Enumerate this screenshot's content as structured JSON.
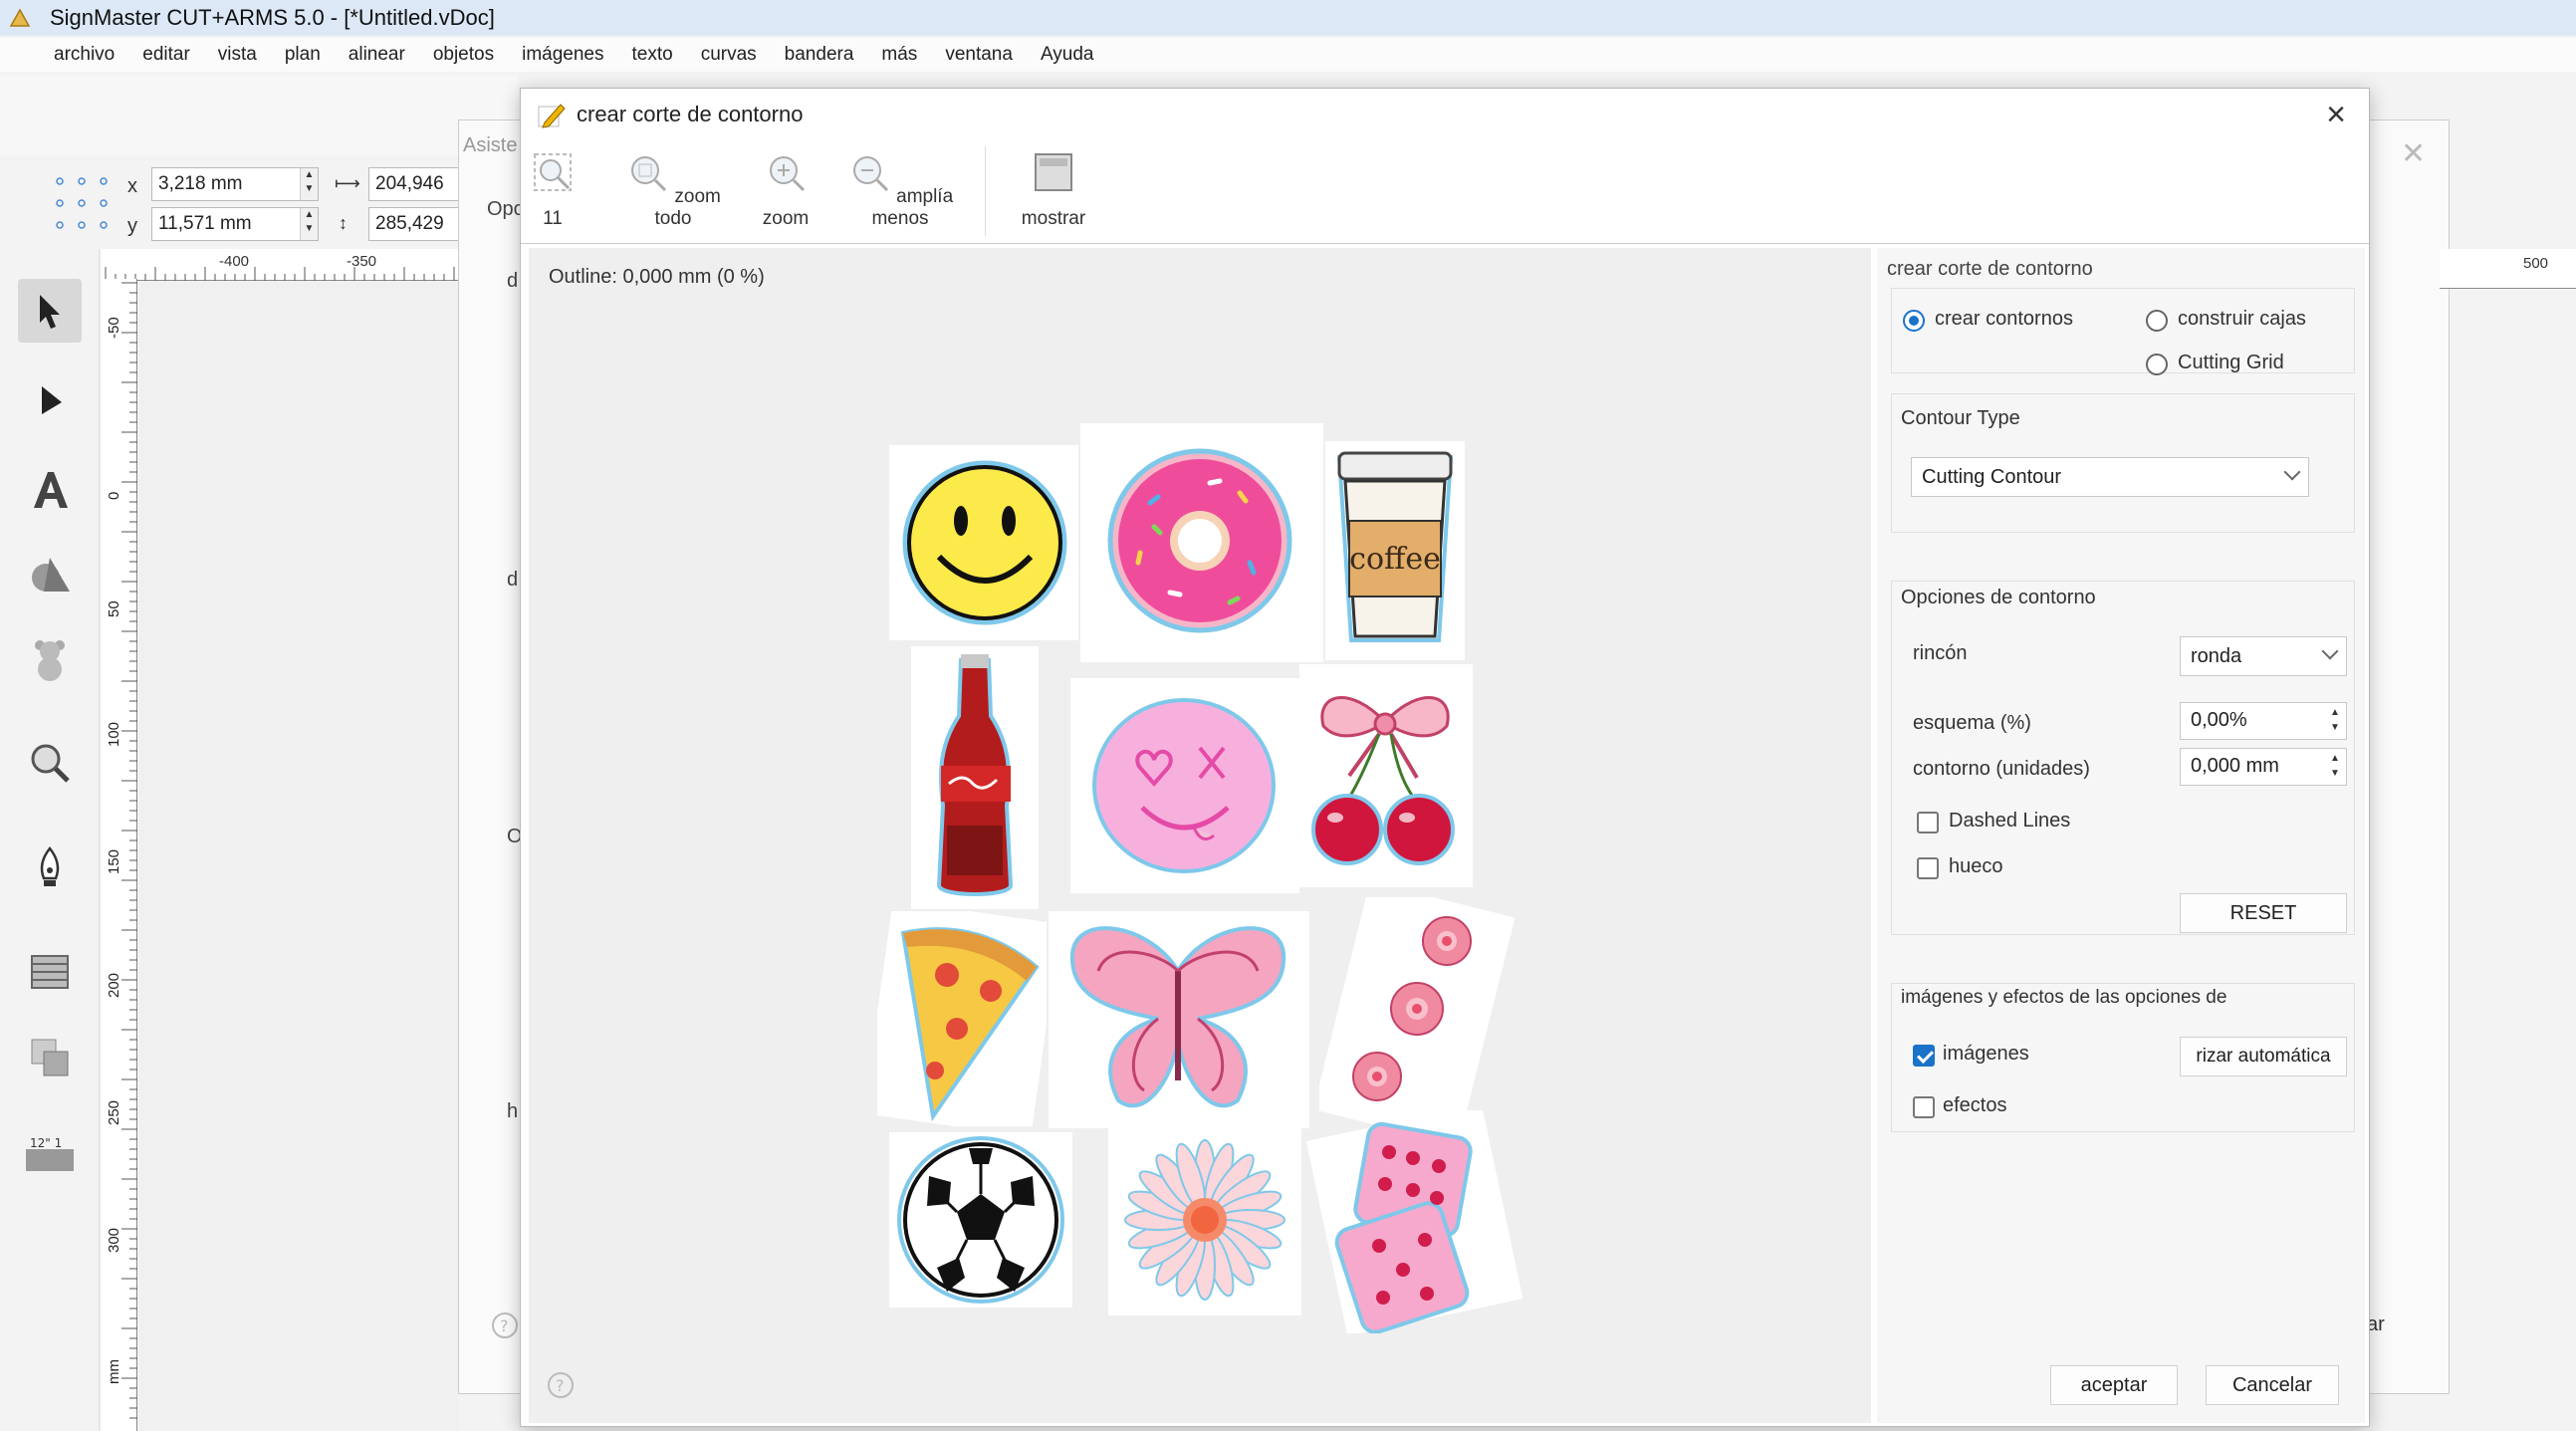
{
  "app": {
    "title": "SignMaster CUT+ARMS 5.0 - [*Untitled.vDoc]"
  },
  "menu": [
    "archivo",
    "editar",
    "vista",
    "plan",
    "alinear",
    "objetos",
    "imágenes",
    "texto",
    "curvas",
    "bandera",
    "más",
    "ventana",
    "Ayuda"
  ],
  "coords": {
    "x_label": "x",
    "x_value": "3,218 mm",
    "y_label": "y",
    "y_value": "11,571 mm",
    "w_value": "204,946",
    "h_value": "285,429"
  },
  "ruler": {
    "h_ticks": [
      "-400",
      "-350"
    ],
    "v_ticks": [
      "-50",
      "0",
      "50",
      "100",
      "150",
      "200",
      "250",
      "300"
    ],
    "right_tick": "500",
    "unit": "mm"
  },
  "background_fragments": {
    "asist": "Asiste",
    "opc": "Opc",
    "d1": "d",
    "d2": "d",
    "o": "O",
    "h": "h",
    "ar": "ar"
  },
  "dialog": {
    "title": "crear corte de contorno",
    "tools": [
      {
        "label": "11",
        "icon": "zoom-fit-icon"
      },
      {
        "label": "zoom todo",
        "icon": "zoom-all-icon"
      },
      {
        "label": "zoom",
        "icon": "zoom-in-icon"
      },
      {
        "label": "amplía menos",
        "icon": "zoom-out-icon"
      },
      {
        "label": "mostrar",
        "icon": "display-icon"
      }
    ],
    "outline_status": "Outline: 0,000 mm (0 %)",
    "panel": {
      "heading": "crear corte de contorno",
      "mode_options": [
        {
          "label": "crear contornos",
          "selected": true
        },
        {
          "label": "construir cajas",
          "selected": false
        },
        {
          "label": "Cutting Grid",
          "selected": false
        }
      ],
      "contour_type_label": "Contour Type",
      "contour_type_value": "Cutting Contour",
      "options_label": "Opciones de contorno",
      "corner_label": "rincón",
      "corner_value": "ronda",
      "outline_pct_label": "esquema (%)",
      "outline_pct_value": "0,00%",
      "contour_units_label": "contorno (unidades)",
      "contour_units_value": "0,000 mm",
      "dashed_lines_label": "Dashed Lines",
      "dashed_lines_checked": false,
      "hollow_label": "hueco",
      "hollow_checked": false,
      "reset_label": "RESET",
      "images_effects_label": "imágenes y efectos de las opciones de",
      "images_label": "imágenes",
      "images_checked": true,
      "effects_label": "efectos",
      "effects_checked": false,
      "auto_button_label": "rizar automática"
    },
    "coffee_text": "coffee",
    "ok_label": "aceptar",
    "cancel_label": "Cancelar",
    "help_icon": "help-icon"
  },
  "colors": {
    "accent": "#1a73c8",
    "titlebar": "#dce8f6",
    "pink": "#f06aa8"
  }
}
